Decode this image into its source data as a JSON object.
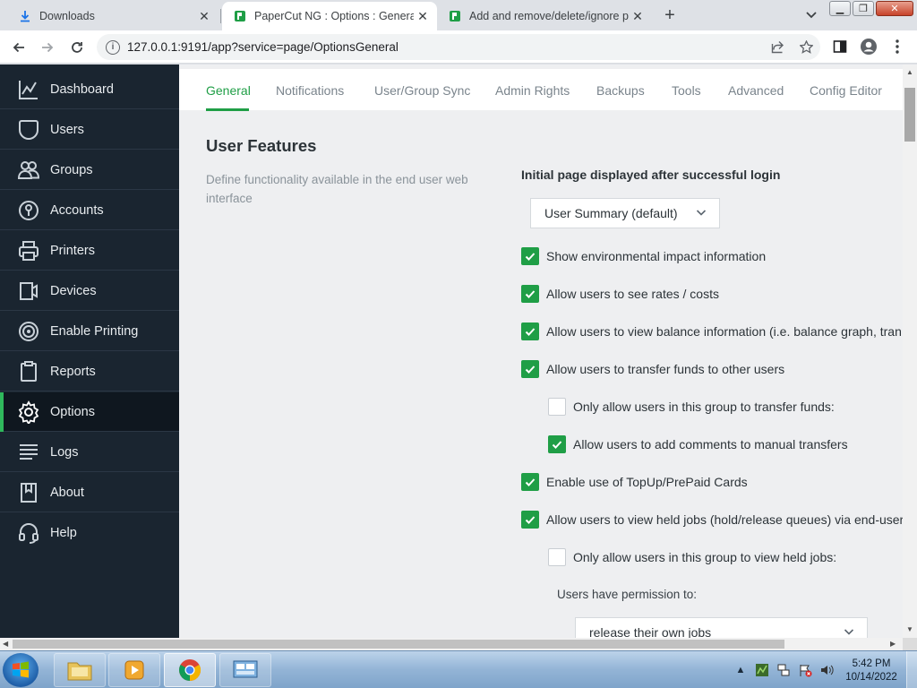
{
  "browser": {
    "tabs": [
      {
        "title": "Downloads",
        "icon": "download-icon",
        "active": false
      },
      {
        "title": "PaperCut NG : Options : General",
        "icon": "papercut-icon",
        "active": true
      },
      {
        "title": "Add and remove/delete/ignore p",
        "icon": "papercut-icon",
        "active": false
      }
    ],
    "url": "127.0.0.1:9191/app?service=page/OptionsGeneral"
  },
  "sidebar": {
    "items": [
      {
        "label": "Dashboard",
        "icon": "dashboard-icon"
      },
      {
        "label": "Users",
        "icon": "users-icon"
      },
      {
        "label": "Groups",
        "icon": "groups-icon"
      },
      {
        "label": "Accounts",
        "icon": "accounts-icon"
      },
      {
        "label": "Printers",
        "icon": "printers-icon"
      },
      {
        "label": "Devices",
        "icon": "devices-icon"
      },
      {
        "label": "Enable Printing",
        "icon": "enable-printing-icon"
      },
      {
        "label": "Reports",
        "icon": "reports-icon"
      },
      {
        "label": "Options",
        "icon": "options-icon"
      },
      {
        "label": "Logs",
        "icon": "logs-icon"
      },
      {
        "label": "About",
        "icon": "about-icon"
      },
      {
        "label": "Help",
        "icon": "help-icon"
      }
    ],
    "active": "Options",
    "accent_color": "#2fb85c"
  },
  "subtabs": [
    "General",
    "Notifications",
    "User/Group Sync",
    "Admin Rights",
    "Backups",
    "Tools",
    "Advanced",
    "Config Editor"
  ],
  "section": {
    "title": "User Features",
    "description": "Define functionality available in the end user web interface",
    "initial_page_label": "Initial page displayed after successful login",
    "initial_page_value": "User Summary (default)",
    "options": [
      {
        "label": "Show environmental impact information",
        "checked": true
      },
      {
        "label": "Allow users to see rates / costs",
        "checked": true
      },
      {
        "label": "Allow users to view balance information (i.e. balance graph, tran",
        "checked": true
      },
      {
        "label": "Allow users to transfer funds to other users",
        "checked": true
      },
      {
        "label": "Only allow users in this group to transfer funds:",
        "checked": false
      },
      {
        "label": "Allow users to add comments to manual transfers",
        "checked": true
      },
      {
        "label": "Enable use of TopUp/PrePaid Cards",
        "checked": true
      },
      {
        "label": "Allow users to view held jobs (hold/release queues) via end-user",
        "checked": true
      },
      {
        "label": "Only allow users in this group to view held jobs:",
        "checked": false
      }
    ],
    "permission_label": "Users have permission to:",
    "permission_value": "release their own jobs",
    "check_color": "#1f9e46"
  },
  "taskbar": {
    "time": "5:42 PM",
    "date": "10/14/2022"
  }
}
